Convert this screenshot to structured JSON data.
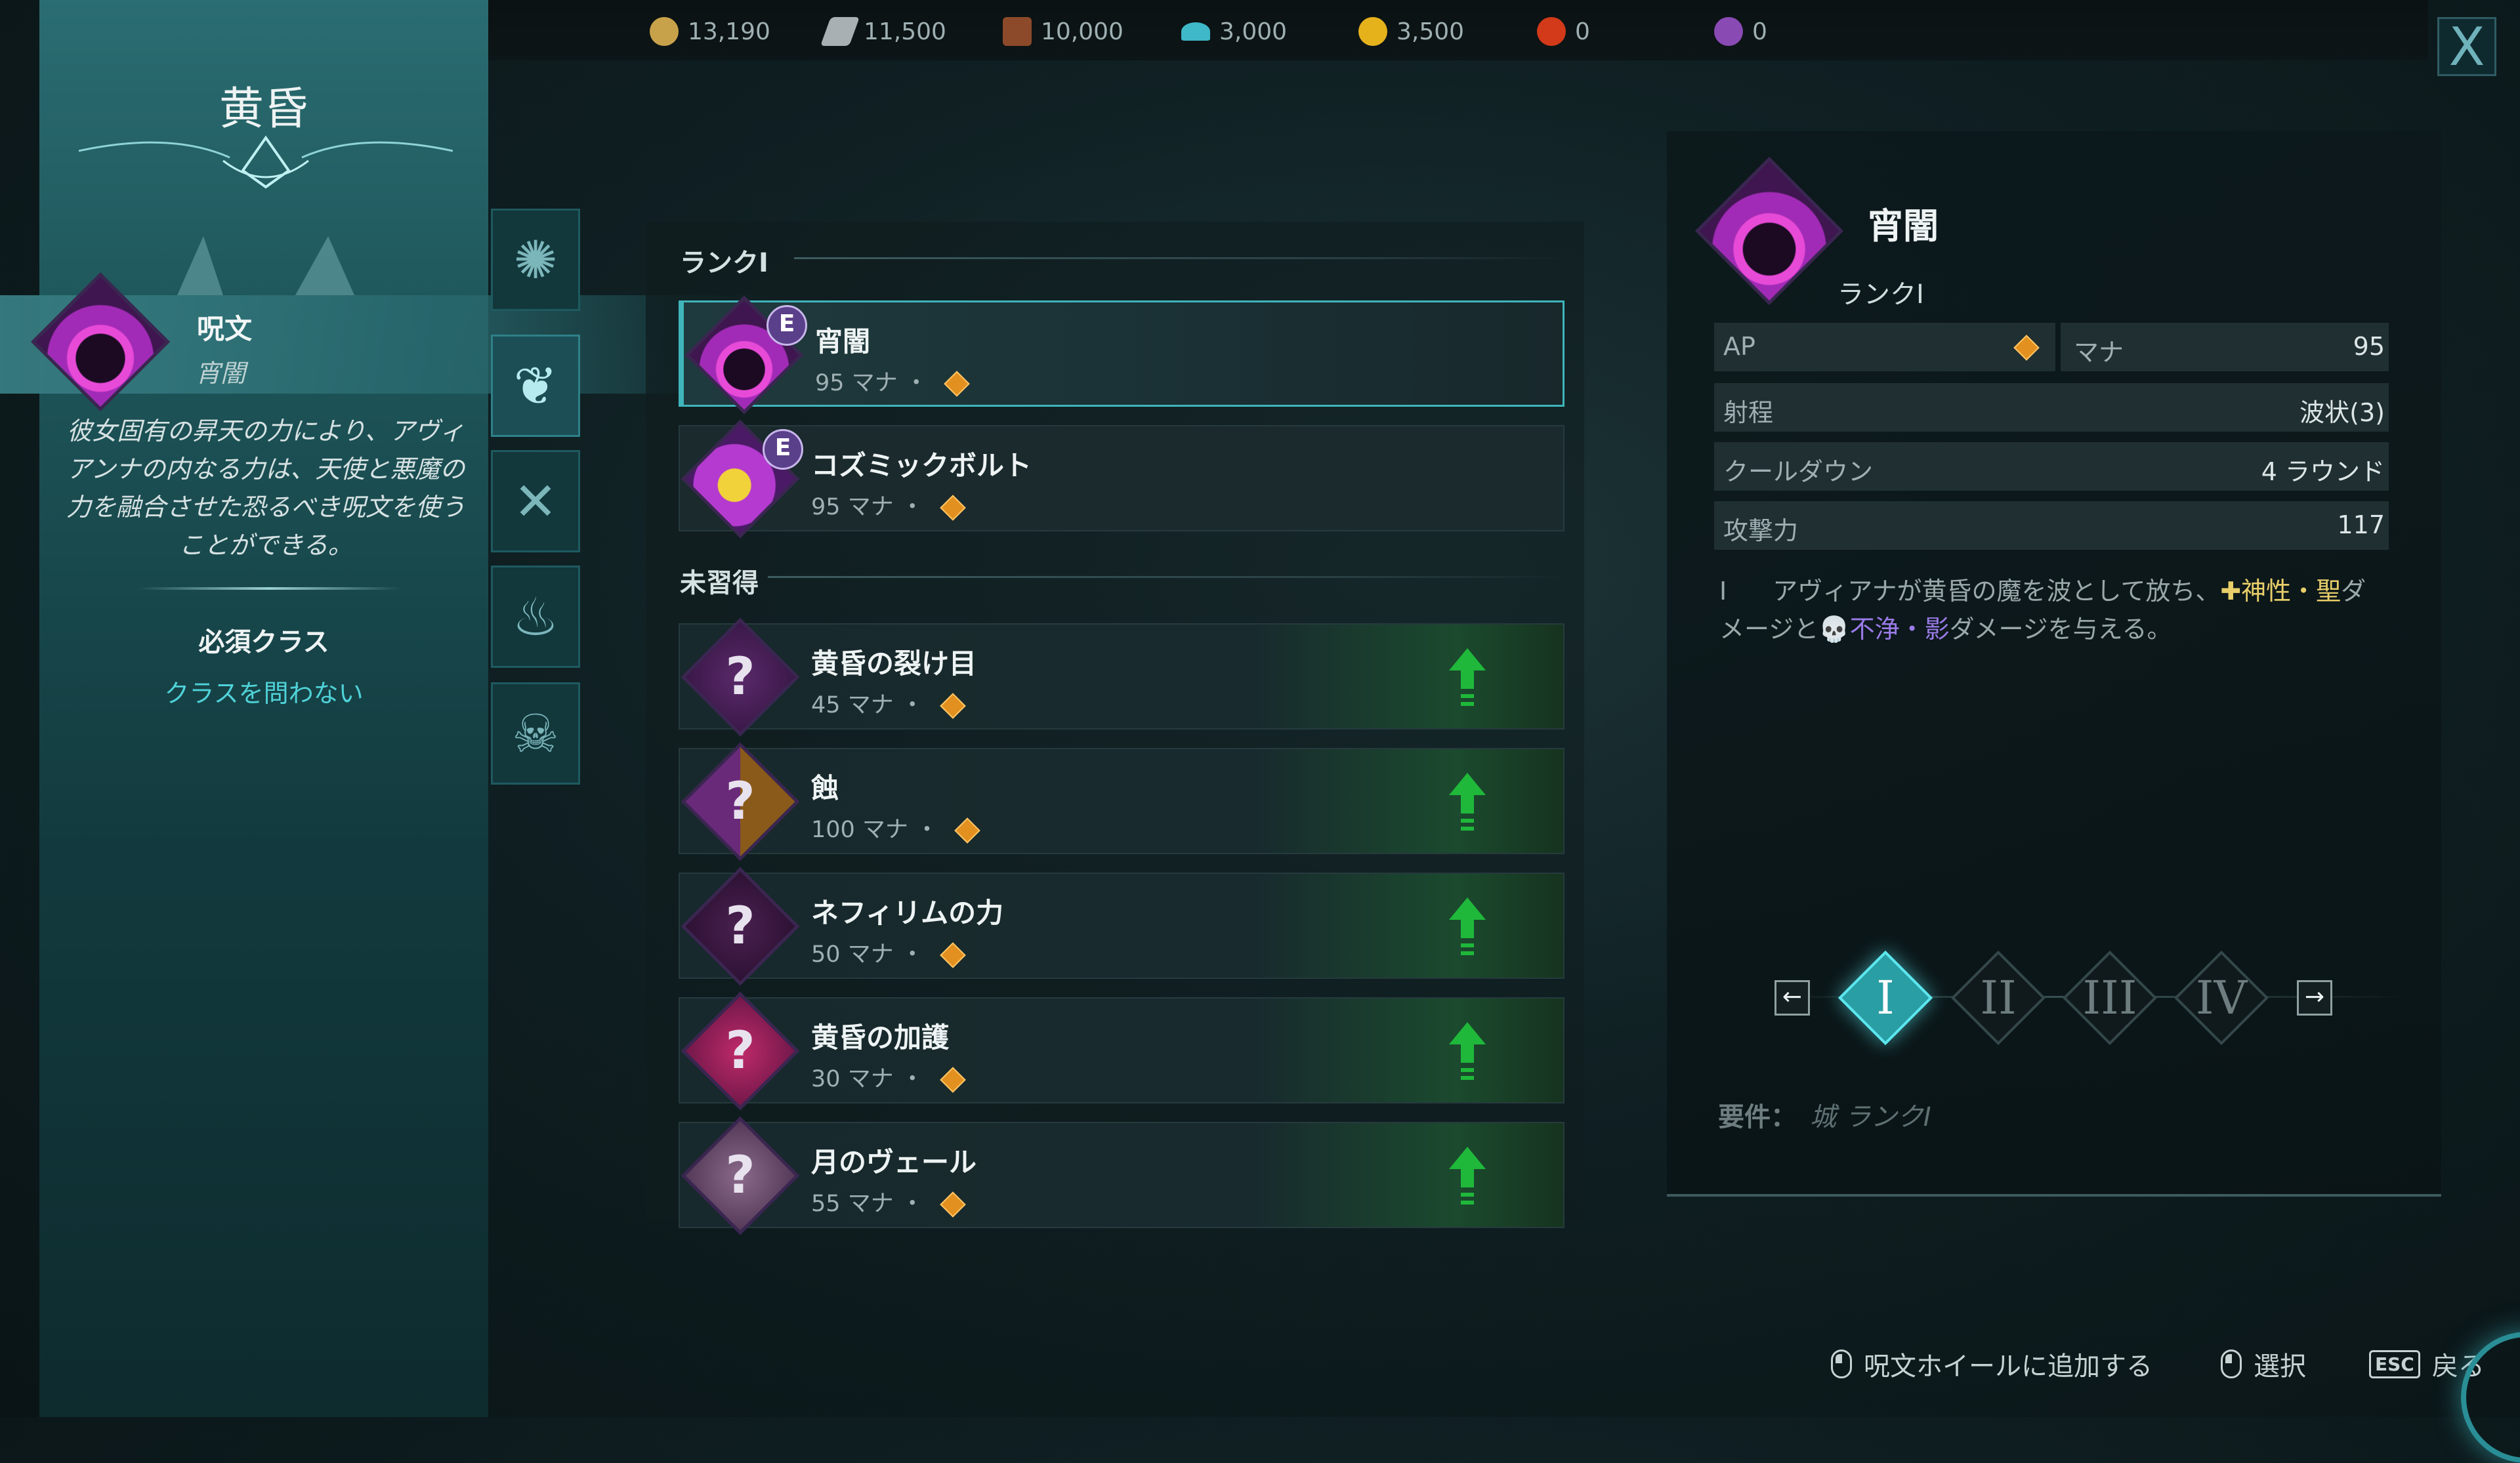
{
  "resources": [
    {
      "icon": "gold-coins-icon",
      "value": "13,190",
      "color": "#c8a24a"
    },
    {
      "icon": "stone-icon",
      "value": "11,500",
      "color": "#a9b0b4"
    },
    {
      "icon": "wood-icon",
      "value": "10,000",
      "color": "#8c4a2a"
    },
    {
      "icon": "crystal-icon",
      "value": "3,000",
      "color": "#3fb8c8"
    },
    {
      "icon": "imperium-icon",
      "value": "3,500",
      "color": "#e6b21c"
    },
    {
      "icon": "red-mana-icon",
      "value": "0",
      "color": "#d23a1a"
    },
    {
      "icon": "purple-mana-icon",
      "value": "0",
      "color": "#8a4ab4"
    }
  ],
  "close_label": "X",
  "left_panel": {
    "title": "黄昏",
    "spell_type": "呪文",
    "spell_name": "宵闇",
    "description": "彼女固有の昇天の力により、アヴィアンナの内なる力は、天使と悪魔の力を融合させた恐るべき呪文を使うことができる。",
    "required_class_label": "必須クラス",
    "required_class_value": "クラスを問わない"
  },
  "tabs": [
    {
      "icon": "eye-icon"
    },
    {
      "icon": "wings-icon"
    },
    {
      "icon": "crossed-swords-icon"
    },
    {
      "icon": "flame-icon"
    },
    {
      "icon": "skull-icon"
    }
  ],
  "list": {
    "rank_section": "ランクI",
    "unlearned_section": "未習得",
    "learned": [
      {
        "name": "宵闇",
        "cost": "95 マナ ・",
        "badge": "E"
      },
      {
        "name": "コズミックボルト",
        "cost": "95 マナ ・",
        "badge": "E"
      }
    ],
    "unlearned": [
      {
        "name": "黄昏の裂け目",
        "cost": "45 マナ ・"
      },
      {
        "name": "蝕",
        "cost": "100 マナ ・"
      },
      {
        "name": "ネフィリムの力",
        "cost": "50 マナ ・"
      },
      {
        "name": "黄昏の加護",
        "cost": "30 マナ ・"
      },
      {
        "name": "月のヴェール",
        "cost": "55 マナ ・"
      }
    ],
    "unknown_glyph": "?"
  },
  "detail": {
    "name": "宵闇",
    "rank": "ランクI",
    "stats": {
      "ap_label": "AP",
      "mana_label": "マナ",
      "mana_value": "95",
      "range_label": "射程",
      "range_value": "波状(3)",
      "cooldown_label": "クールダウン",
      "cooldown_value": "4 ラウンド",
      "attack_label": "攻撃力",
      "attack_value": "117"
    },
    "desc_prefix": "I",
    "desc_part1": "アヴィアナが黄昏の魔を波として放ち、",
    "desc_holy": "✚神性・聖",
    "desc_part2": "ダメージと",
    "desc_unholy": "💀不浄・影",
    "desc_part3": "ダメージを与える。",
    "rank_selector": {
      "left_arrow": "←",
      "right_arrow": "→",
      "ranks": [
        "I",
        "II",
        "III",
        "IV"
      ],
      "active_rank": "I"
    },
    "requirement_label": "要件：",
    "requirement_value": "城 ランクI"
  },
  "footer": {
    "add_label": "呪文ホイールに追加する",
    "select_label": "選択",
    "esc_key": "ESC",
    "back_label": "戻る"
  }
}
